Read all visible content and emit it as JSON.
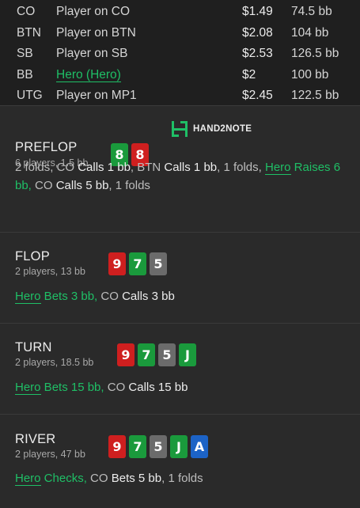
{
  "players": [
    {
      "pos": "CO",
      "name": "Player on CO",
      "stack": "$1.49",
      "bb": "74.5 bb",
      "hero": false
    },
    {
      "pos": "BTN",
      "name": "Player on BTN",
      "stack": "$2.08",
      "bb": "104 bb",
      "hero": false
    },
    {
      "pos": "SB",
      "name": "Player on SB",
      "stack": "$2.53",
      "bb": "126.5 bb",
      "hero": false
    },
    {
      "pos": "BB",
      "name": "Hero (Hero)",
      "stack": "$2",
      "bb": "100 bb",
      "hero": true
    },
    {
      "pos": "UTG",
      "name": "Player on MP1",
      "stack": "$2.45",
      "bb": "122.5 bb",
      "hero": false
    }
  ],
  "logo": {
    "text": "HAND2NOTE",
    "icon": "h2n-logo-icon"
  },
  "colors": {
    "red": "#cf1f1f",
    "green": "#1a9a3c",
    "grey": "#6b6b6b",
    "blue": "#1c63c6",
    "hero": "#1fbf66"
  },
  "streets": {
    "preflop": {
      "title": "PREFLOP",
      "sub": "6 players, 1.5 bb",
      "cards": [
        {
          "rank": "8",
          "color": "green"
        },
        {
          "rank": "8",
          "color": "red"
        }
      ],
      "actions": {
        "a1": "2 folds, CO ",
        "a2": "Calls 1 bb",
        ",": ", BTN ",
        "a3": "Calls 1 bb",
        "a4": ", 1 folds, ",
        "hero": "Hero",
        "hero_act": " Raises 6 bb,",
        "a5": " CO ",
        "a6": "Calls 5 bb",
        "a7": ", 1 folds"
      }
    },
    "flop": {
      "title": "FLOP",
      "sub": "2 players, 13 bb",
      "cards": [
        {
          "rank": "9",
          "color": "red"
        },
        {
          "rank": "7",
          "color": "green"
        },
        {
          "rank": "5",
          "color": "grey"
        }
      ],
      "actions": {
        "hero": "Hero",
        "hero_act": " Bets 3 bb,",
        "a1": " CO ",
        "a2": "Calls 3 bb"
      }
    },
    "turn": {
      "title": "TURN",
      "sub": "2 players, 18.5 bb",
      "cards": [
        {
          "rank": "9",
          "color": "red"
        },
        {
          "rank": "7",
          "color": "green"
        },
        {
          "rank": "5",
          "color": "grey"
        },
        {
          "rank": "J",
          "color": "green"
        }
      ],
      "actions": {
        "hero": "Hero",
        "hero_act": " Bets 15 bb,",
        "a1": " CO ",
        "a2": "Calls 15 bb"
      }
    },
    "river": {
      "title": "RIVER",
      "sub": "2 players, 47 bb",
      "cards": [
        {
          "rank": "9",
          "color": "red"
        },
        {
          "rank": "7",
          "color": "green"
        },
        {
          "rank": "5",
          "color": "grey"
        },
        {
          "rank": "J",
          "color": "green"
        },
        {
          "rank": "A",
          "color": "blue"
        }
      ],
      "actions": {
        "hero": "Hero",
        "hero_act": " Checks,",
        "a1": " CO ",
        "a2": "Bets 5 bb",
        "a3": ", 1 folds"
      }
    }
  }
}
